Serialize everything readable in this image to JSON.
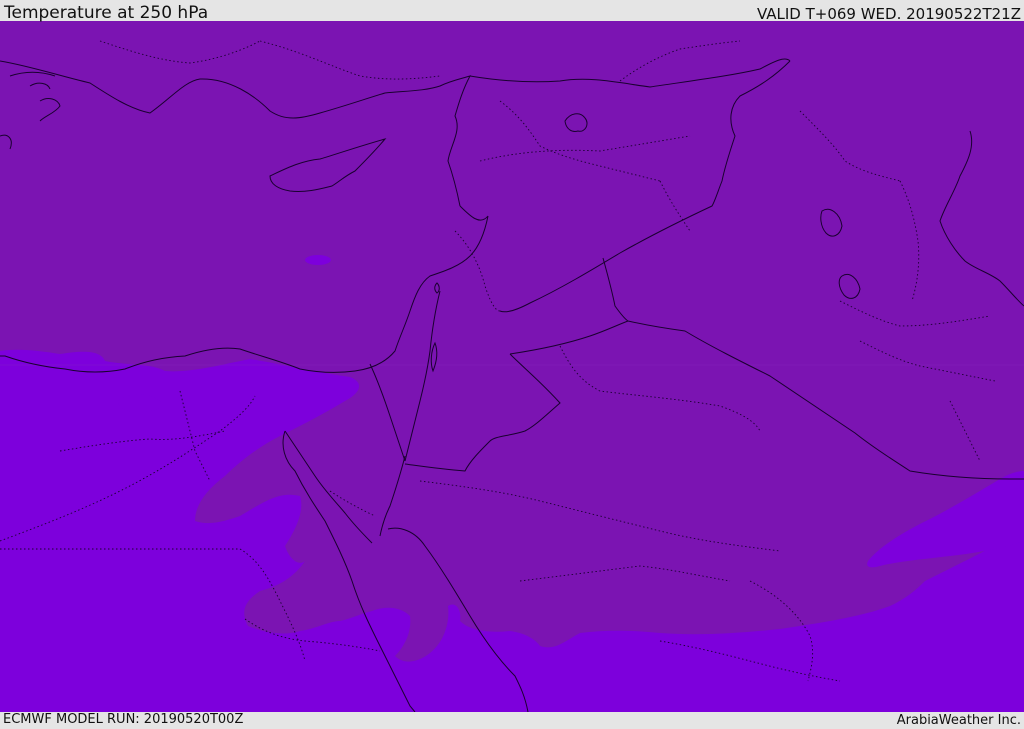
{
  "header": {
    "title": "Temperature at 250 hPa",
    "valid": "VALID T+069 WED. 20190522T21Z"
  },
  "footer": {
    "model_run": "ECMWF MODEL RUN: 20190520T00Z",
    "credit": "ArabiaWeather Inc."
  },
  "map": {
    "colors": {
      "warm_band": "#7b14b2",
      "cold_band": "#7d00dc",
      "coastline": "#1a0030",
      "border": "#1a0030"
    }
  }
}
